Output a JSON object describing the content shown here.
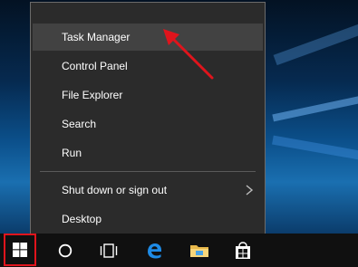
{
  "context_menu": {
    "items": [
      {
        "label": "Task Manager",
        "highlighted": true
      },
      {
        "label": "Control Panel"
      },
      {
        "label": "File Explorer"
      },
      {
        "label": "Search"
      },
      {
        "label": "Run"
      },
      {
        "label": "Shut down or sign out",
        "has_submenu": true
      },
      {
        "label": "Desktop"
      }
    ]
  },
  "taskbar": {
    "icons": [
      "windows-start-icon",
      "cortana-circle-icon",
      "task-view-icon",
      "edge-icon",
      "file-explorer-icon",
      "store-icon"
    ]
  },
  "colors": {
    "menu_bg": "#2b2b2b",
    "menu_highlight": "#424242",
    "annotation_red": "#e0141c",
    "edge_blue": "#1e8be6"
  }
}
